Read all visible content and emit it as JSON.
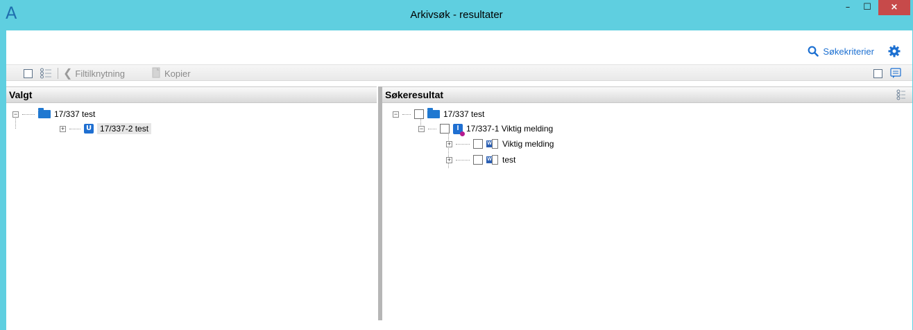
{
  "window": {
    "title": "Arkivsøk - resultater",
    "app_icon": "app-logo-icon",
    "controls": {
      "minimize": "–",
      "maximize": "☐",
      "close": "×"
    }
  },
  "actions": {
    "search_criteria_label": "Søkekriterier",
    "search_icon": "search-icon",
    "settings_icon": "gear-icon"
  },
  "toolbar": {
    "filtilknytning_label": "Filtilknytning",
    "kopier_label": "Kopier"
  },
  "left_panel": {
    "header": "Valgt",
    "tree": [
      {
        "label": "17/337 test",
        "icon": "folder-icon"
      },
      {
        "label": "17/337-2 test",
        "icon": "u-badge-icon",
        "badge": "U"
      }
    ]
  },
  "right_panel": {
    "header": "Søkeresultat",
    "tree": [
      {
        "label": "17/337 test",
        "icon": "folder-icon"
      },
      {
        "label": "17/337-1 Viktig melding",
        "icon": "i-badge-icon",
        "badge": "I"
      },
      {
        "label": "Viktig melding",
        "icon": "word-doc-icon"
      },
      {
        "label": "test",
        "icon": "word-doc-icon"
      }
    ]
  },
  "colors": {
    "titlebar": "#5fcfe0",
    "accent_blue": "#1b6fd1",
    "close_red": "#c74a4a"
  }
}
